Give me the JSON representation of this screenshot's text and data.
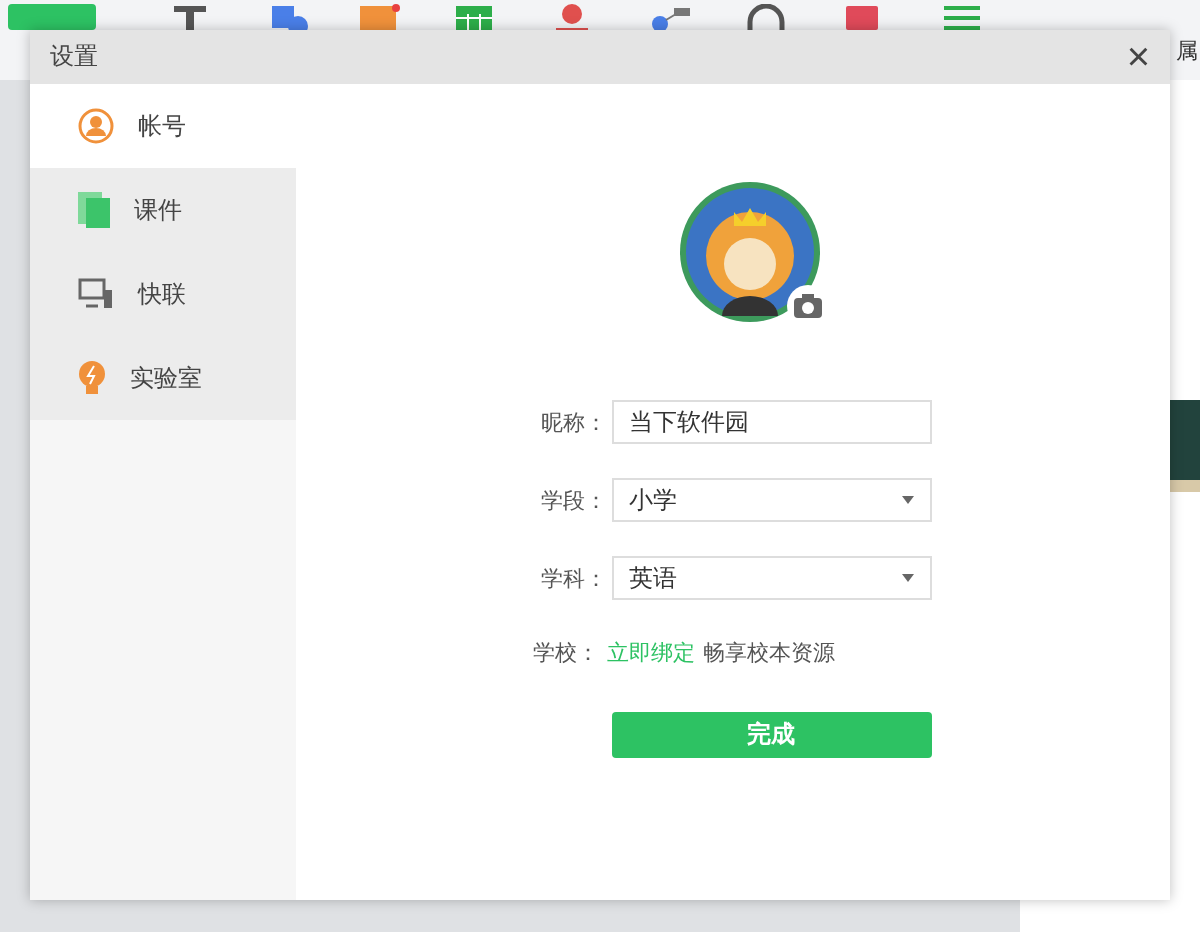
{
  "side_panel": {
    "title": "属"
  },
  "dialog": {
    "title": "设置",
    "close": "×",
    "sidebar": [
      {
        "label": "帐号",
        "selected": true
      },
      {
        "label": "课件",
        "selected": false
      },
      {
        "label": "快联",
        "selected": false
      },
      {
        "label": "实验室",
        "selected": false
      }
    ],
    "fields": [
      {
        "kind": "text",
        "label": "昵称：",
        "value": "当下软件园"
      },
      {
        "kind": "select",
        "label": "学段：",
        "value": "小学"
      },
      {
        "kind": "select",
        "label": "学科：",
        "value": "英语"
      }
    ],
    "school": {
      "label": "学校：",
      "link": "立即绑定",
      "note": "畅享校本资源"
    },
    "submit": "完成"
  }
}
